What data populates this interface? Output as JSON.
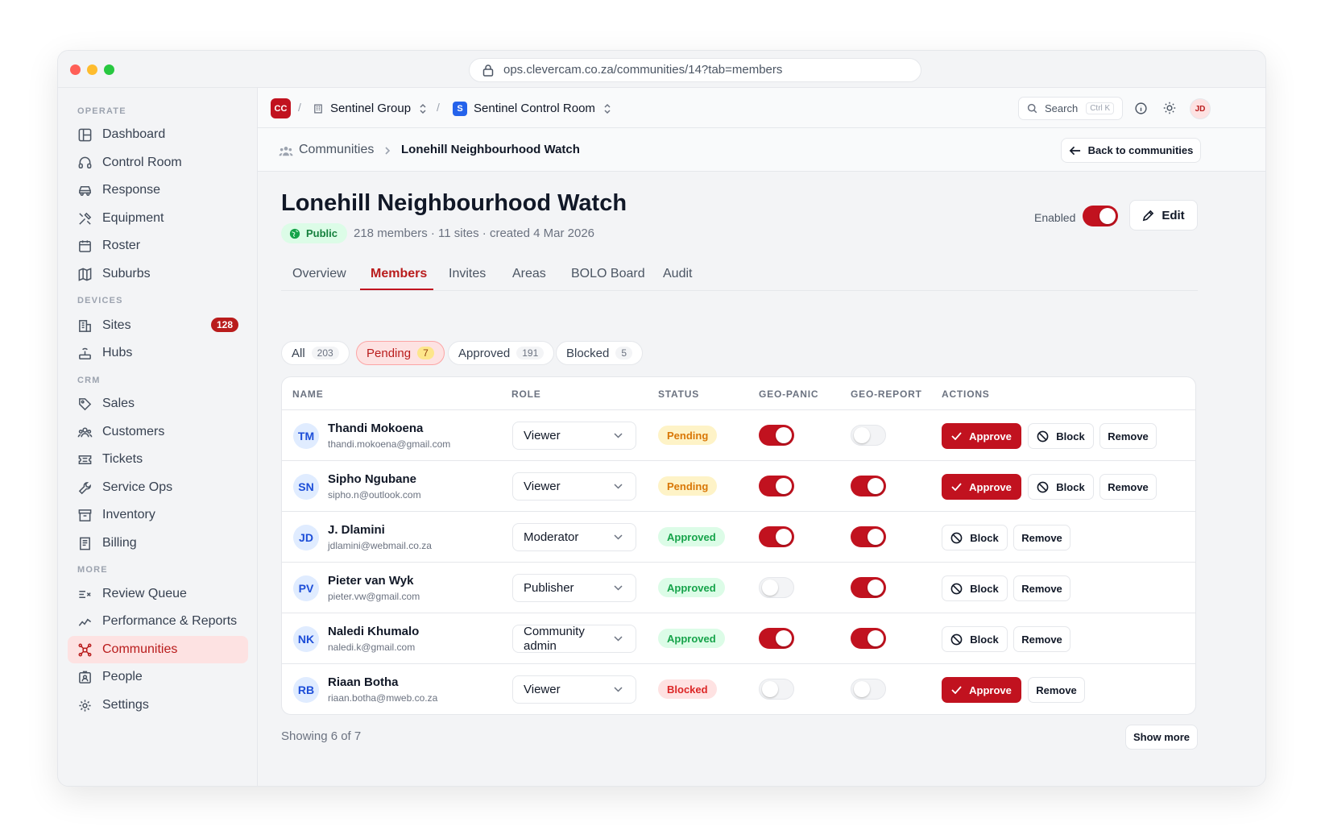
{
  "browser": {
    "url": "ops.clevercam.co.za/communities/14?tab=members"
  },
  "sidebar": {
    "sections": {
      "operate": "OPERATE",
      "devices": "DEVICES",
      "crm": "CRM",
      "more": "MORE"
    },
    "items": [
      {
        "label": "Dashboard"
      },
      {
        "label": "Control Room"
      },
      {
        "label": "Response"
      },
      {
        "label": "Equipment"
      },
      {
        "label": "Roster"
      },
      {
        "label": "Suburbs"
      },
      {
        "label": "Sites",
        "badge": "128"
      },
      {
        "label": "Hubs"
      },
      {
        "label": "Sales"
      },
      {
        "label": "Customers"
      },
      {
        "label": "Tickets"
      },
      {
        "label": "Service Ops"
      },
      {
        "label": "Inventory"
      },
      {
        "label": "Billing"
      },
      {
        "label": "Review Queue"
      },
      {
        "label": "Performance & Reports"
      },
      {
        "label": "Communities"
      },
      {
        "label": "People"
      },
      {
        "label": "Settings"
      }
    ]
  },
  "topbar": {
    "org_logo": "CC",
    "org": "Sentinel Group",
    "sep": "/",
    "workspace_logo": "S",
    "workspace": "Sentinel Control Room",
    "search_label": "Search",
    "search_kbd": "Ctrl K",
    "user_initials": "JD"
  },
  "breadcrumb": {
    "parent": "Communities",
    "current": "Lonehill Neighbourhood Watch",
    "back_label": "Back to communities"
  },
  "community": {
    "title": "Lonehill Neighbourhood Watch",
    "visibility": "Public",
    "meta": "218 members · 11 sites · created 4 Mar 2026",
    "enabled_label": "Enabled",
    "enabled": true,
    "edit_label": "Edit"
  },
  "tabs": [
    {
      "label": "Overview"
    },
    {
      "label": "Members",
      "active": true
    },
    {
      "label": "Invites"
    },
    {
      "label": "Areas"
    },
    {
      "label": "BOLO Board"
    },
    {
      "label": "Audit"
    }
  ],
  "filters": [
    {
      "label": "All",
      "count": "203"
    },
    {
      "label": "Pending",
      "count": "7",
      "active": true
    },
    {
      "label": "Approved",
      "count": "191"
    },
    {
      "label": "Blocked",
      "count": "5"
    }
  ],
  "table": {
    "columns": {
      "name": "NAME",
      "role": "ROLE",
      "status": "STATUS",
      "geo_panic": "GEO-PANIC",
      "geo_report": "GEO-REPORT",
      "actions": "ACTIONS"
    },
    "actions": {
      "approve": "Approve",
      "block": "Block",
      "remove": "Remove"
    },
    "rows": [
      {
        "initials": "TM",
        "name": "Thandi Mokoena",
        "email": "thandi.mokoena@gmail.com",
        "role": "Viewer",
        "status": "Pending",
        "geo_panic": true,
        "geo_report": false
      },
      {
        "initials": "SN",
        "name": "Sipho Ngubane",
        "email": "sipho.n@outlook.com",
        "role": "Viewer",
        "status": "Pending",
        "geo_panic": true,
        "geo_report": true
      },
      {
        "initials": "JD",
        "name": "J. Dlamini",
        "email": "jdlamini@webmail.co.za",
        "role": "Moderator",
        "status": "Approved",
        "geo_panic": true,
        "geo_report": true
      },
      {
        "initials": "PV",
        "name": "Pieter van Wyk",
        "email": "pieter.vw@gmail.com",
        "role": "Publisher",
        "status": "Approved",
        "geo_panic": false,
        "geo_report": true
      },
      {
        "initials": "NK",
        "name": "Naledi Khumalo",
        "email": "naledi.k@gmail.com",
        "role": "Community admin",
        "status": "Approved",
        "geo_panic": true,
        "geo_report": true
      },
      {
        "initials": "RB",
        "name": "Riaan Botha",
        "email": "riaan.botha@mweb.co.za",
        "role": "Viewer",
        "status": "Blocked",
        "geo_panic": false,
        "geo_report": false
      }
    ]
  },
  "footer": {
    "showing": "Showing 6 of 7",
    "show_more": "Show more"
  },
  "colors": {
    "accent": "#c1121f",
    "accent_soft": "#fde2e2",
    "pending": "#d97706",
    "approved": "#16a34a",
    "blocked": "#dc2626"
  }
}
